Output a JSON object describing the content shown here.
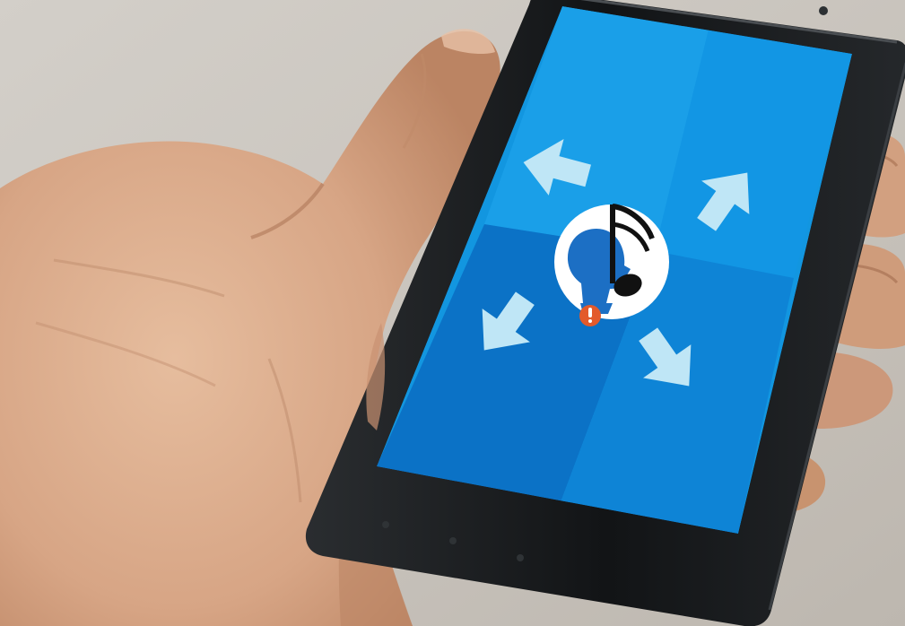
{
  "photo": {
    "subject": "hand-holding-smartphone",
    "colors": {
      "background": "#c9c4bd",
      "skin": "#d9a582",
      "skin_shadow": "#b07d5e",
      "phone_body": "#17191b",
      "screen_blue_light": "#1aa0ea",
      "screen_blue_mid": "#0e8ddc",
      "screen_blue_dark": "#0b6ec2",
      "arrow": "#bfe6f6",
      "logo_circle": "#ffffff",
      "logo_head": "#1c6fc4",
      "note": "#111111",
      "badge": "#e35a2b"
    }
  },
  "screen": {
    "arrows": [
      {
        "icon": "arrow-up-left-icon",
        "direction": "up-left"
      },
      {
        "icon": "arrow-up-right-icon",
        "direction": "up-right"
      },
      {
        "icon": "arrow-down-left-icon",
        "direction": "down-left"
      },
      {
        "icon": "arrow-down-right-icon",
        "direction": "down-right"
      }
    ],
    "app_icon": {
      "icon": "app-logo-icon",
      "elements": [
        "head-silhouette",
        "music-note",
        "notification-dot"
      ]
    }
  }
}
